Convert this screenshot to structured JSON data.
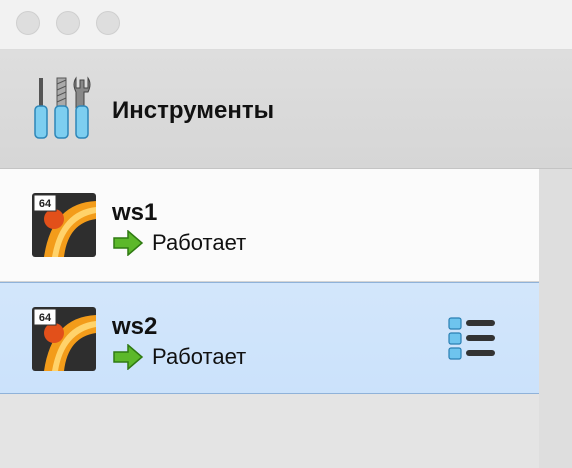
{
  "window": {
    "controls": [
      "close",
      "minimize",
      "zoom"
    ]
  },
  "tools": {
    "title": "Инструменты",
    "icon": "tools-icon"
  },
  "machines": [
    {
      "name": "ws1",
      "status": "Работает",
      "badge": "64",
      "selected": false
    },
    {
      "name": "ws2",
      "status": "Работает",
      "badge": "64",
      "selected": true
    }
  ],
  "colors": {
    "selection": "#cbe2fb",
    "running_arrow": "#5cb82a",
    "os_orange": "#f39c1a"
  }
}
